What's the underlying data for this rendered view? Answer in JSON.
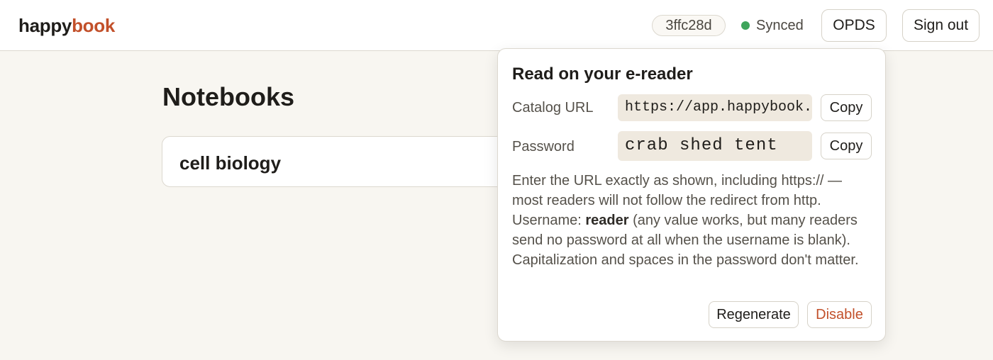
{
  "header": {
    "logo_part1": "happy",
    "logo_part2": "book",
    "commit": "3ffc28d",
    "sync_status": "Synced",
    "opds_label": "OPDS",
    "signout_label": "Sign out"
  },
  "main": {
    "title": "Notebooks",
    "notebooks": [
      {
        "name": "cell biology"
      }
    ]
  },
  "popover": {
    "title": "Read on your e-reader",
    "catalog_label": "Catalog URL",
    "catalog_url": "https://app.happybook.pr",
    "password_label": "Password",
    "password": "crab shed tent",
    "copy_label": "Copy",
    "help_part1": "Enter the URL exactly as shown, including https:// — most readers will not follow the redirect from http. Username: ",
    "help_username": "reader",
    "help_part2": " (any value works, but many readers send no password at all when the username is blank). Capitalization and spaces in the password don't matter.",
    "regenerate_label": "Regenerate",
    "disable_label": "Disable"
  },
  "colors": {
    "accent": "#c2502a",
    "synced_dot": "#3fa55b",
    "background": "#f8f6f1",
    "field_bg": "#efe9df"
  },
  "icons": {
    "sync_indicator": "status-dot-icon"
  }
}
